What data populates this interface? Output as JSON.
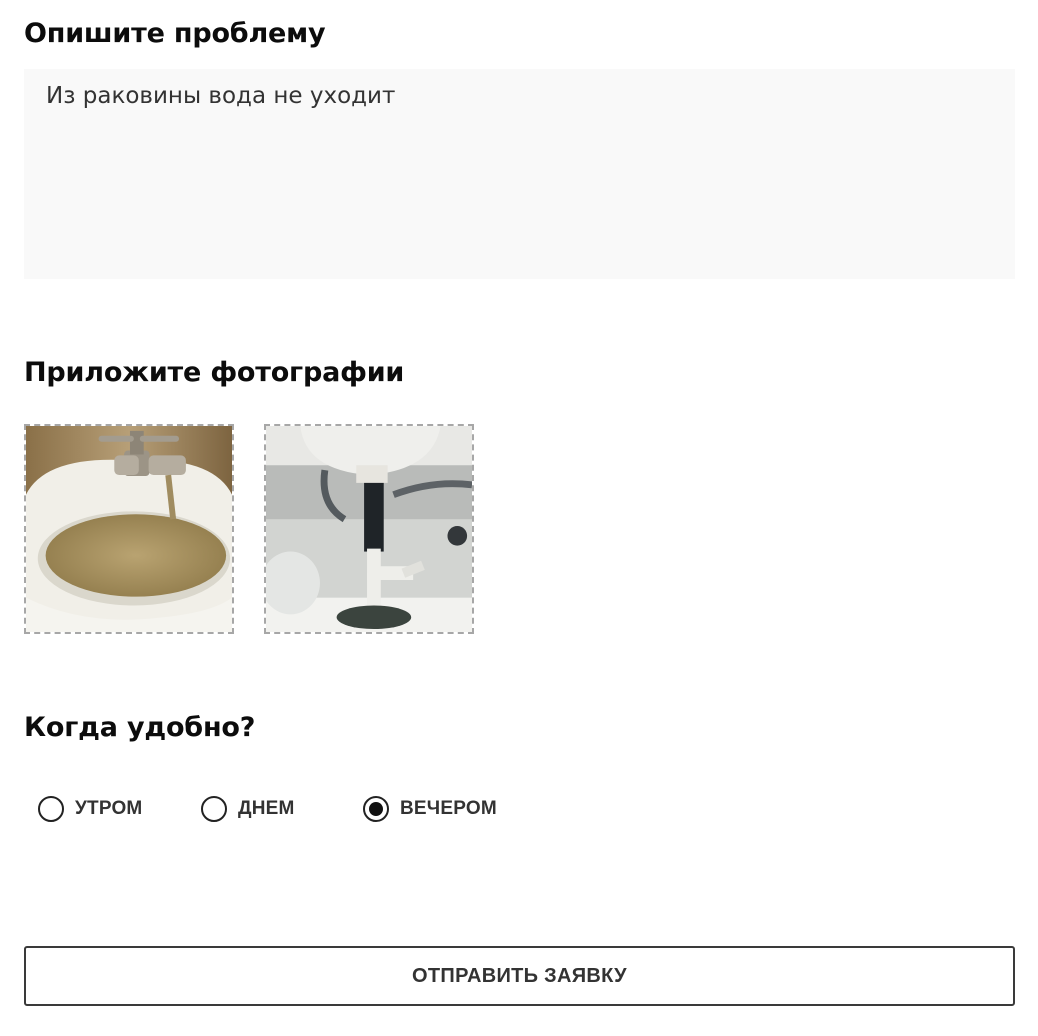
{
  "problem": {
    "heading": "Опишите проблему",
    "text": "Из раковины вода не уходит"
  },
  "photos": {
    "heading": "Приложите фотографии",
    "items": [
      {
        "name": "sink-photo"
      },
      {
        "name": "drain-pipe-photo"
      }
    ]
  },
  "schedule": {
    "heading": "Когда удобно?",
    "options": [
      {
        "label": "УТРОМ",
        "checked": false
      },
      {
        "label": "ДНЕМ",
        "checked": false
      },
      {
        "label": "ВЕЧЕРОМ",
        "checked": true
      }
    ]
  },
  "submit": {
    "label": "ОТПРАВИТЬ ЗАЯВКУ"
  }
}
